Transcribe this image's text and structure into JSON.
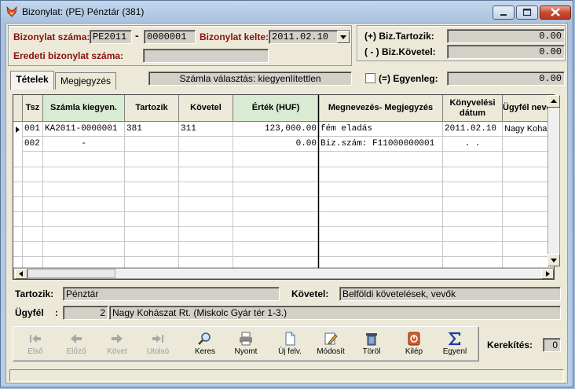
{
  "window": {
    "title": "Bizonylat: (PE) Pénztár (381)"
  },
  "header": {
    "doc_number_label": "Bizonylat száma:",
    "doc_prefix": "PE2011",
    "doc_separator": "-",
    "doc_number": "0000001",
    "doc_date_label": "Bizonylat kelte:",
    "doc_date": "2011.02.10",
    "original_doc_label": "Eredeti bizonylat száma:",
    "original_doc_value": ""
  },
  "totals": {
    "debit_label": "(+) Biz.Tartozik:",
    "debit_value": "0.00",
    "credit_label": "( - ) Biz.Követel:",
    "credit_value": "0.00",
    "balance_label": "(=) Egyenleg:",
    "balance_value": "0.00"
  },
  "tabs": {
    "items_label": "Tételek",
    "notes_label": "Megjegyzés",
    "invoice_choice": "Számla választás: kiegyenlítettlen"
  },
  "grid": {
    "columns": [
      "Tsz",
      "Számla kiegyen.",
      "Tartozik",
      "Követel",
      "Érték (HUF)",
      "Megnevezés- Megjegyzés",
      "Könyvelési dátum",
      "Ügyfél neve"
    ],
    "rows": [
      [
        "001",
        "KA2011-0000001",
        "381",
        "311",
        "123,000.00",
        "fém eladás",
        "2011.02.10",
        "Nagy Koha"
      ],
      [
        "002",
        "-",
        "",
        "",
        "0.00",
        "Biz.szám: F11000000001",
        ".  .",
        ""
      ]
    ]
  },
  "details": {
    "debit_label": "Tartozik:",
    "debit_value": "Pénztár",
    "credit_label": "Követel:",
    "credit_value": "Belföldi követelések, vevők",
    "client_label": "Ügyfél",
    "client_colon": ":",
    "client_id": "2",
    "client_name": "Nagy Kohászat Rt. (Miskolc Gyár tér 1-3.)"
  },
  "toolbar": {
    "first": "Első",
    "prev": "Előző",
    "next": "Követ",
    "last": "Utolsó",
    "search": "Keres",
    "print": "Nyomt",
    "new": "Új felv.",
    "edit": "Módosít",
    "delete": "Töröl",
    "exit": "Kilép",
    "balance": "Egyenl"
  },
  "rounding": {
    "label": "Kerekítés:",
    "value": "0"
  }
}
